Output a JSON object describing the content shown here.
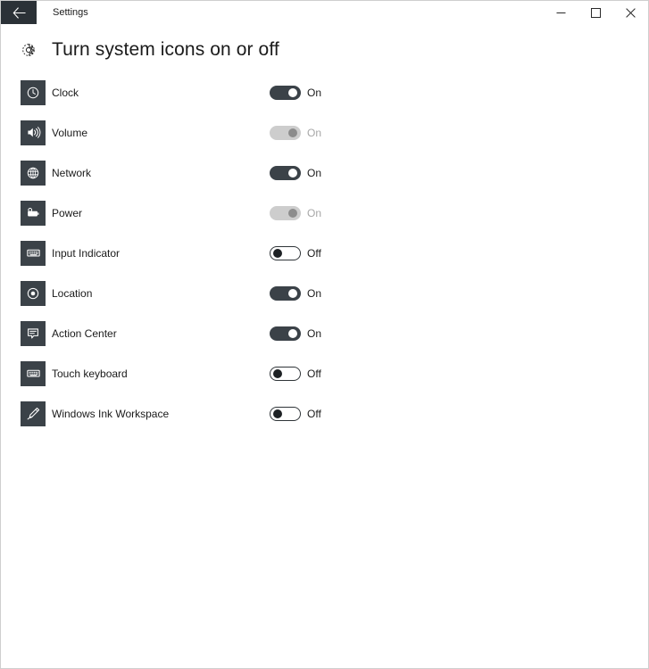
{
  "window": {
    "title": "Settings",
    "back_icon": "back-arrow-icon",
    "controls": {
      "minimize_label": "Minimize",
      "maximize_label": "Maximize",
      "close_label": "Close"
    }
  },
  "page": {
    "icon": "gear-icon",
    "title": "Turn system icons on or off"
  },
  "colors": {
    "icon_tile": "#3b4248",
    "toggle_on": "#3b4248",
    "toggle_off_border": "#2f3438",
    "toggle_disabled": "#cdcdcd",
    "toggle_disabled_knob": "#8c8c8c",
    "text": "#1a1a1a",
    "text_disabled": "#a6a6a6",
    "titlebar_back": "#2b3137"
  },
  "rows": [
    {
      "name": "Clock",
      "icon": "clock-icon",
      "state": "On",
      "toggle": "on",
      "enabled": true
    },
    {
      "name": "Volume",
      "icon": "volume-icon",
      "state": "On",
      "toggle": "disabled",
      "enabled": false
    },
    {
      "name": "Network",
      "icon": "network-globe-icon",
      "state": "On",
      "toggle": "on",
      "enabled": true
    },
    {
      "name": "Power",
      "icon": "battery-icon",
      "state": "On",
      "toggle": "disabled",
      "enabled": false
    },
    {
      "name": "Input Indicator",
      "icon": "keyboard-icon",
      "state": "Off",
      "toggle": "off",
      "enabled": true
    },
    {
      "name": "Location",
      "icon": "location-target-icon",
      "state": "On",
      "toggle": "on",
      "enabled": true
    },
    {
      "name": "Action Center",
      "icon": "chat-bubble-icon",
      "state": "On",
      "toggle": "on",
      "enabled": true
    },
    {
      "name": "Touch keyboard",
      "icon": "keyboard-icon",
      "state": "Off",
      "toggle": "off",
      "enabled": true
    },
    {
      "name": "Windows Ink Workspace",
      "icon": "pen-icon",
      "state": "Off",
      "toggle": "off",
      "enabled": true
    }
  ]
}
